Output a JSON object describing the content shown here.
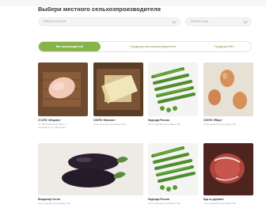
{
  "page": {
    "title": "Выбери местного сельхозпроизводителя"
  },
  "filters": {
    "category_placeholder": "Выбрать категорию",
    "city_placeholder": "Выбрать город"
  },
  "tabs": [
    {
      "label": "Все производители",
      "active": true
    },
    {
      "label": "Продукция сельхозпроизводителей",
      "active": false
    },
    {
      "label": "Продукция КФХ",
      "active": false
    }
  ],
  "colors": {
    "accent": "#86b44a",
    "accent_text": "#7a9a4a"
  },
  "products": [
    {
      "name": "СССПК «Медово»",
      "subtitle_lines": [
        "РТ, Балтасинский район, с.",
        "Кушлавыш ул. Школьная"
      ],
      "image": "chicken-fillet"
    },
    {
      "name": "СХКПК «Молоко»",
      "subtitle_lines": [
        "Село деревня Кушлавыш 3М"
      ],
      "image": "cheese"
    },
    {
      "name": "Надежда Россия",
      "subtitle_lines": [
        "Село деревня Кушлавыш 3М"
      ],
      "image": "green-beans"
    },
    {
      "name": "СХКПК «Яйцо»",
      "subtitle_lines": [
        "Село деревня Кушлавыш 3М"
      ],
      "image": "eggs"
    },
    {
      "name": "Владимир Сотов",
      "subtitle_lines": [
        "Село деревня Кушлавыш 3М"
      ],
      "image": "eggplant"
    },
    {
      "name": "Надежда Россия",
      "subtitle_lines": [
        "Село деревня Кушлавыш 3М"
      ],
      "image": "green-beans"
    },
    {
      "name": "Еда из деревни",
      "subtitle_lines": [
        "Село деревня Кушлавыш 3М"
      ],
      "image": "raw-meat"
    }
  ]
}
